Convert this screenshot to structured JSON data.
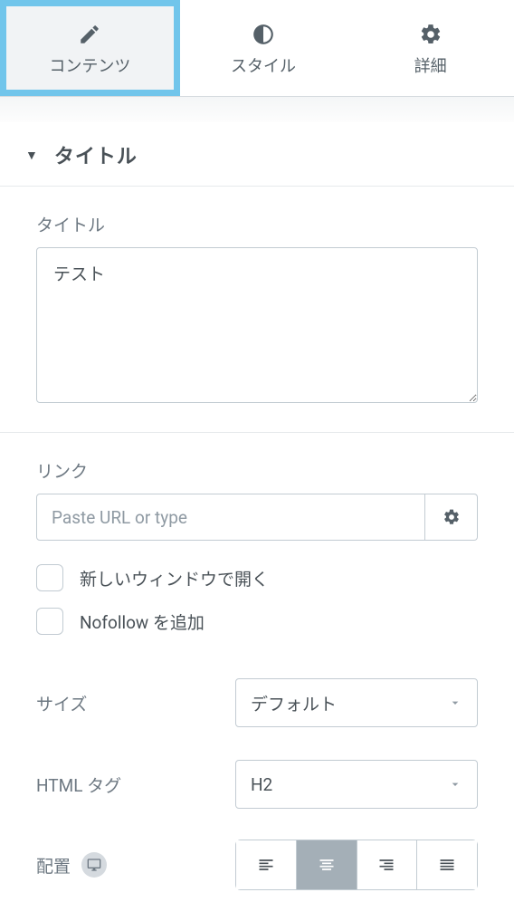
{
  "tabs": {
    "content": "コンテンツ",
    "style": "スタイル",
    "advanced": "詳細"
  },
  "section": {
    "title": "タイトル"
  },
  "fields": {
    "title_label": "タイトル",
    "title_value": "テスト",
    "link_label": "リンク",
    "link_placeholder": "Paste URL or type",
    "open_new_window": "新しいウィンドウで開く",
    "add_nofollow": "Nofollow を追加",
    "size_label": "サイズ",
    "size_value": "デフォルト",
    "html_tag_label": "HTML タグ",
    "html_tag_value": "H2",
    "alignment_label": "配置"
  }
}
